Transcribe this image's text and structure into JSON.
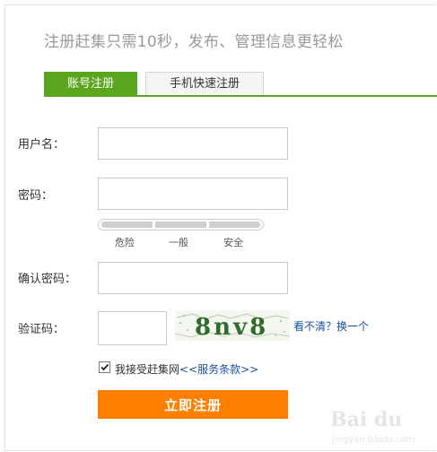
{
  "header": {
    "headline": "注册赶集只需10秒，发布、管理信息更轻松"
  },
  "tabs": [
    {
      "label": "账号注册",
      "active": true
    },
    {
      "label": "手机快速注册",
      "active": false
    }
  ],
  "form": {
    "username": {
      "label": "用户名：",
      "value": ""
    },
    "password": {
      "label": "密码：",
      "value": ""
    },
    "strength": {
      "labels": [
        "危险",
        "一般",
        "安全"
      ]
    },
    "confirm": {
      "label": "确认密码：",
      "value": ""
    },
    "captcha": {
      "label": "验证码：",
      "value": "",
      "image_text": "8nv8",
      "refresh_link": "看不清？换一个"
    },
    "agreement": {
      "checked": true,
      "text": "我接受赶集网",
      "link": "<<服务条款>>"
    },
    "submit_label": "立即注册"
  },
  "watermark": {
    "logo": "Bai du",
    "sub": "jingyan.baidu.com"
  },
  "colors": {
    "brand_green": "#5ba51f",
    "submit_orange": "#ff7f00",
    "link_blue": "#1a4e9c",
    "headline_gray": "#9a9a9a"
  }
}
